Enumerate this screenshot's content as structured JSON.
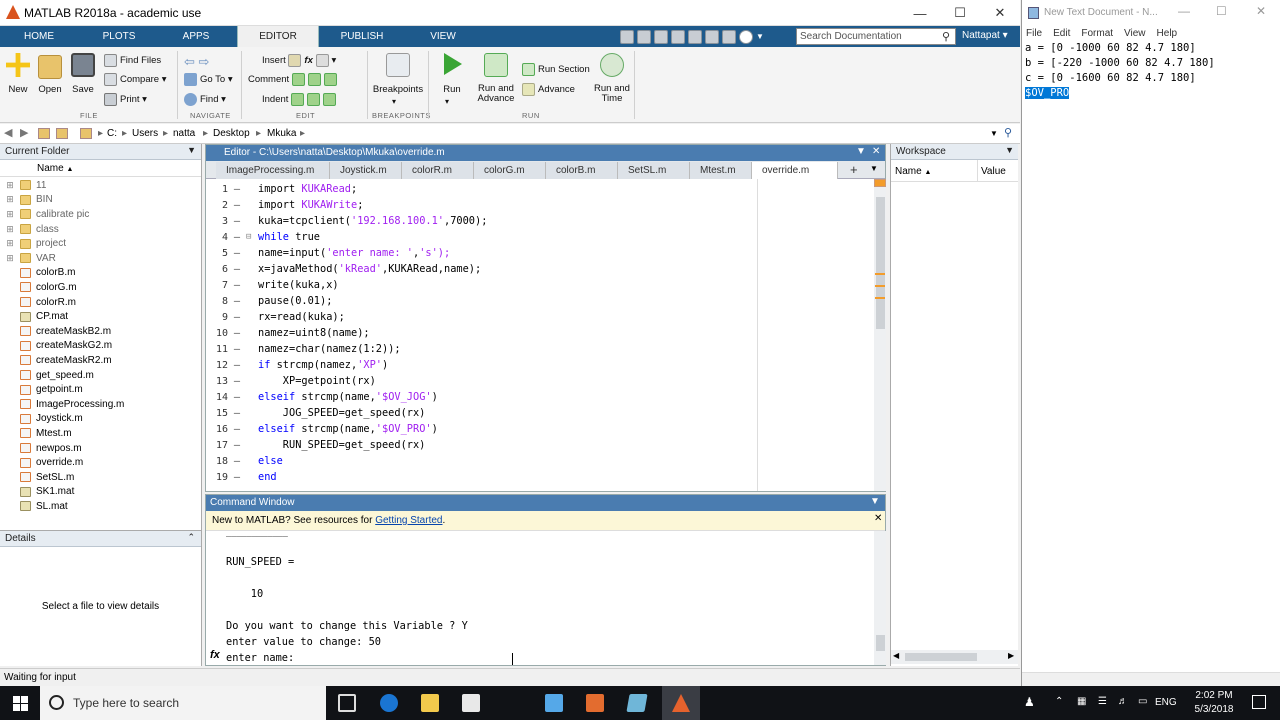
{
  "window": {
    "title": "MATLAB R2018a - academic use"
  },
  "ribbon_tabs": [
    "HOME",
    "PLOTS",
    "APPS",
    "EDITOR",
    "PUBLISH",
    "VIEW"
  ],
  "search": {
    "placeholder": "Search Documentation"
  },
  "user": "Nattapat",
  "ribbon": {
    "file": {
      "new": "New",
      "open": "Open",
      "save": "Save",
      "find_files": "Find Files",
      "compare": "Compare",
      "print": "Print",
      "section": "FILE"
    },
    "navigate": {
      "go_to": "Go To",
      "find": "Find",
      "section": "NAVIGATE"
    },
    "edit": {
      "insert": "Insert",
      "comment": "Comment",
      "indent": "Indent",
      "section": "EDIT"
    },
    "breakpoints": {
      "label": "Breakpoints",
      "section": "BREAKPOINTS"
    },
    "run": {
      "run": "Run",
      "run_advance_1": "Run and",
      "run_advance_2": "Advance",
      "run_section": "Run Section",
      "advance": "Advance",
      "run_time_1": "Run and",
      "run_time_2": "Time",
      "section": "RUN"
    }
  },
  "address": {
    "crumbs": [
      "C:",
      "Users",
      "natta",
      "Desktop",
      "Mkuka"
    ]
  },
  "current_folder": {
    "title": "Current Folder",
    "column": "Name",
    "folders": [
      "11",
      "BIN",
      "calibrate pic",
      "class",
      "project",
      "VAR"
    ],
    "files": [
      "colorB.m",
      "colorG.m",
      "colorR.m",
      "CP.mat",
      "createMaskB2.m",
      "createMaskG2.m",
      "createMaskR2.m",
      "get_speed.m",
      "getpoint.m",
      "ImageProcessing.m",
      "Joystick.m",
      "Mtest.m",
      "newpos.m",
      "override.m",
      "SetSL.m",
      "SK1.mat",
      "SL.mat"
    ]
  },
  "details": {
    "title": "Details",
    "message": "Select a file to view details"
  },
  "editor": {
    "title": "Editor - C:\\Users\\natta\\Desktop\\Mkuka\\override.m",
    "tabs": [
      "ImageProcessing.m",
      "Joystick.m",
      "colorR.m",
      "colorG.m",
      "colorB.m",
      "SetSL.m",
      "Mtest.m",
      "override.m"
    ],
    "active_tab": "override.m"
  },
  "code_lines": [
    [
      "",
      "import ",
      "",
      "KUKARead",
      ";"
    ],
    [
      "",
      "import ",
      "",
      "KUKAWrite",
      ";"
    ],
    [
      "",
      "kuka=tcpclient(",
      "'192.168.100.1'",
      ",7000);",
      ""
    ],
    [
      "while",
      " true",
      "",
      "",
      ""
    ],
    [
      "",
      "name=input(",
      "'enter name: '",
      ",",
      "'s');"
    ],
    [
      "",
      "x=javaMethod(",
      "'kRead'",
      ",KUKARead,name);",
      ""
    ],
    [
      "",
      "write(kuka,x)",
      "",
      "",
      ""
    ],
    [
      "",
      "pause(0.01);",
      "",
      "",
      ""
    ],
    [
      "",
      "rx=read(kuka);",
      "",
      "",
      ""
    ],
    [
      "",
      "namez=uint8(name);",
      "",
      "",
      ""
    ],
    [
      "",
      "namez=char(namez(1:2));",
      "",
      "",
      ""
    ],
    [
      "if",
      " strcmp(namez,",
      "'XP'",
      ")",
      ""
    ],
    [
      "",
      "    XP=getpoint(rx)",
      "",
      "",
      ""
    ],
    [
      "elseif",
      " strcmp(name,",
      "'$OV_JOG'",
      ")",
      ""
    ],
    [
      "",
      "    JOG_SPEED=get_speed(rx)",
      "",
      "",
      ""
    ],
    [
      "elseif",
      " strcmp(name,",
      "'$OV_PRO'",
      ")",
      ""
    ],
    [
      "",
      "    RUN_SPEED=get_speed(rx)",
      "",
      "",
      ""
    ],
    [
      "else",
      "",
      "",
      "",
      ""
    ],
    [
      "end",
      "",
      "",
      "",
      ""
    ]
  ],
  "command_window": {
    "title": "Command Window",
    "banner_text": "New to MATLAB? See resources for ",
    "banner_link": "Getting Started",
    "banner_end": ".",
    "lines": [
      "RUN_SPEED =",
      "",
      "    10",
      "",
      "Do you want to change this Variable ? Y",
      "enter value to change: 50",
      "enter name: "
    ]
  },
  "workspace": {
    "title": "Workspace",
    "col_name": "Name",
    "col_value": "Value"
  },
  "status": "Waiting for input",
  "notepad": {
    "title": "New Text Document - N...",
    "menu": [
      "File",
      "Edit",
      "Format",
      "View",
      "Help"
    ],
    "lines": [
      "a = [0 -1000 60 82 4.7 180]",
      "b = [-220 -1000 60 82 4.7 180]",
      "c = [0 -1600 60 82 4.7 180]"
    ],
    "selected": "$OV_PRO"
  },
  "taskbar": {
    "search": "Type here to search",
    "lang": "ENG",
    "time": "2:02 PM",
    "date": "5/3/2018"
  },
  "colors": {
    "matlab_blue": "#1e5a8c",
    "panel_blue": "#4a7cb0",
    "keyword": "#0000ff",
    "string": "#a020f0"
  }
}
